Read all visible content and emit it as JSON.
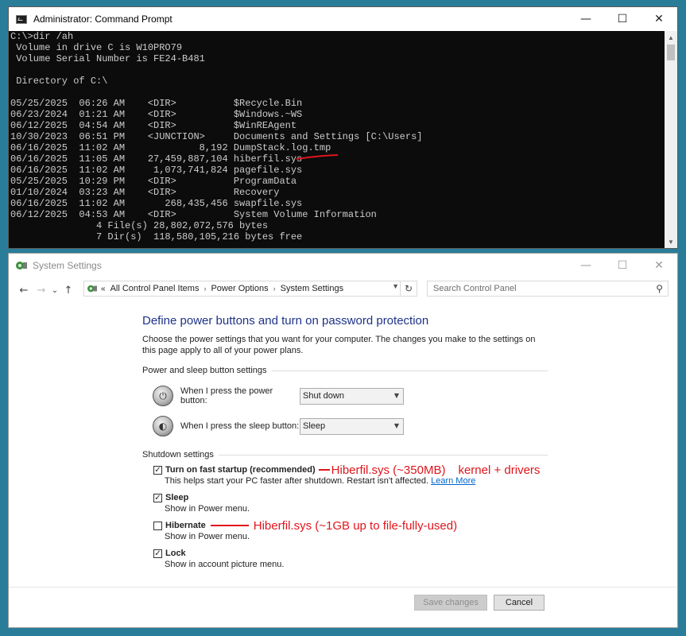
{
  "cmd": {
    "title": "Administrator: Command Prompt",
    "lines": [
      "C:\\>dir /ah",
      " Volume in drive C is W10PRO79",
      " Volume Serial Number is FE24-B481",
      "",
      " Directory of C:\\",
      "",
      "05/25/2025  06:26 AM    <DIR>          $Recycle.Bin",
      "06/23/2024  01:21 AM    <DIR>          $Windows.~WS",
      "06/12/2025  04:54 AM    <DIR>          $WinREAgent",
      "10/30/2023  06:51 PM    <JUNCTION>     Documents and Settings [C:\\Users]",
      "06/16/2025  11:02 AM             8,192 DumpStack.log.tmp",
      "06/16/2025  11:05 AM    27,459,887,104 hiberfil.sys",
      "06/16/2025  11:02 AM     1,073,741,824 pagefile.sys",
      "05/25/2025  10:29 PM    <DIR>          ProgramData",
      "01/10/2024  03:23 AM    <DIR>          Recovery",
      "06/16/2025  11:02 AM       268,435,456 swapfile.sys",
      "06/12/2025  04:53 AM    <DIR>          System Volume Information",
      "               4 File(s) 28,802,072,576 bytes",
      "               7 Dir(s)  118,580,105,216 bytes free"
    ]
  },
  "window_buttons": {
    "minimize": "—",
    "maximize": "☐",
    "close": "✕"
  },
  "settings": {
    "title": "System Settings",
    "nav": {
      "back": "←",
      "forward": "→",
      "recent": "⌄",
      "up": "↑"
    },
    "breadcrumb": {
      "overflow": "«",
      "items": [
        "All Control Panel Items",
        "Power Options",
        "System Settings"
      ],
      "separator": "›"
    },
    "refresh": "↻",
    "search_placeholder": "Search Control Panel",
    "heading": "Define power buttons and turn on password protection",
    "intro": "Choose the power settings that you want for your computer. The changes you make to the settings on this page apply to all of your power plans.",
    "power_group": "Power and sleep button settings",
    "power_button_label": "When I press the power button:",
    "power_button_value": "Shut down",
    "sleep_button_label": "When I press the sleep button:",
    "sleep_button_value": "Sleep",
    "shutdown_group": "Shutdown settings",
    "options": {
      "fast_startup": {
        "label": "Turn on fast startup (recommended)",
        "desc": "This helps start your PC faster after shutdown. Restart isn't affected.",
        "link": "Learn More",
        "checked": true
      },
      "sleep": {
        "label": "Sleep",
        "desc": "Show in Power menu.",
        "checked": true
      },
      "hibernate": {
        "label": "Hibernate",
        "desc": "Show in Power menu.",
        "checked": false
      },
      "lock": {
        "label": "Lock",
        "desc": "Show in account picture menu.",
        "checked": true
      }
    },
    "save_label": "Save changes",
    "cancel_label": "Cancel"
  },
  "annotations": {
    "fast_startup_note": "Hiberfil.sys  (~350MB)",
    "fast_startup_note2": "kernel + drivers",
    "hibernate_note": "Hiberfil.sys (~1GB up to file-fully-used)",
    "color": "#e0151b"
  }
}
